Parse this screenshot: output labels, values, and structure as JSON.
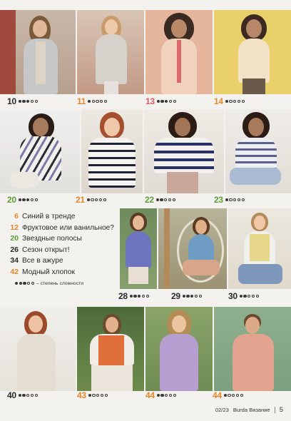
{
  "colors": {
    "orange": "#e3872a",
    "green": "#5e9e3a",
    "pink": "#de5567",
    "dark": "#2a2a2a"
  },
  "photo_captions": [
    {
      "id": "p10",
      "page": "10",
      "difficulty": 3,
      "color": "dark"
    },
    {
      "id": "p11",
      "page": "11",
      "difficulty": 1,
      "color": "orange"
    },
    {
      "id": "p13",
      "page": "13",
      "difficulty": 3,
      "color": "pink"
    },
    {
      "id": "p14",
      "page": "14",
      "difficulty": 1,
      "color": "orange"
    },
    {
      "id": "p20",
      "page": "20",
      "difficulty": 3,
      "color": "green"
    },
    {
      "id": "p21",
      "page": "21",
      "difficulty": 1,
      "color": "orange"
    },
    {
      "id": "p22",
      "page": "22",
      "difficulty": 2,
      "color": "green"
    },
    {
      "id": "p23",
      "page": "23",
      "difficulty": 1,
      "color": "green"
    },
    {
      "id": "p28",
      "page": "28",
      "difficulty": 3,
      "color": "dark"
    },
    {
      "id": "p29",
      "page": "29",
      "difficulty": 3,
      "color": "dark"
    },
    {
      "id": "p30",
      "page": "30",
      "difficulty": 2,
      "color": "dark"
    },
    {
      "id": "p40",
      "page": "40",
      "difficulty": 2,
      "color": "dark"
    },
    {
      "id": "p43a",
      "page": "43",
      "difficulty": 1,
      "color": "orange"
    },
    {
      "id": "p44a",
      "page": "44",
      "difficulty": 2,
      "color": "orange"
    },
    {
      "id": "p44b",
      "page": "44",
      "difficulty": 1,
      "color": "orange"
    }
  ],
  "toc": [
    {
      "page": "6",
      "title": "Синий в тренде",
      "color": "orange"
    },
    {
      "page": "12",
      "title": "Фруктовое или ванильное?",
      "color": "orange"
    },
    {
      "page": "20",
      "title": "Звездные полосы",
      "color": "green"
    },
    {
      "page": "26",
      "title": "Сезон открыт!",
      "color": "dark"
    },
    {
      "page": "34",
      "title": "Все в ажуре",
      "color": "dark"
    },
    {
      "page": "42",
      "title": "Модный хлопок",
      "color": "orange"
    }
  ],
  "legend": {
    "text": "– степень сложности",
    "difficulty": 3
  },
  "footer": {
    "issue": "02/23",
    "magazine": "Burda Вязание",
    "page": "5"
  }
}
